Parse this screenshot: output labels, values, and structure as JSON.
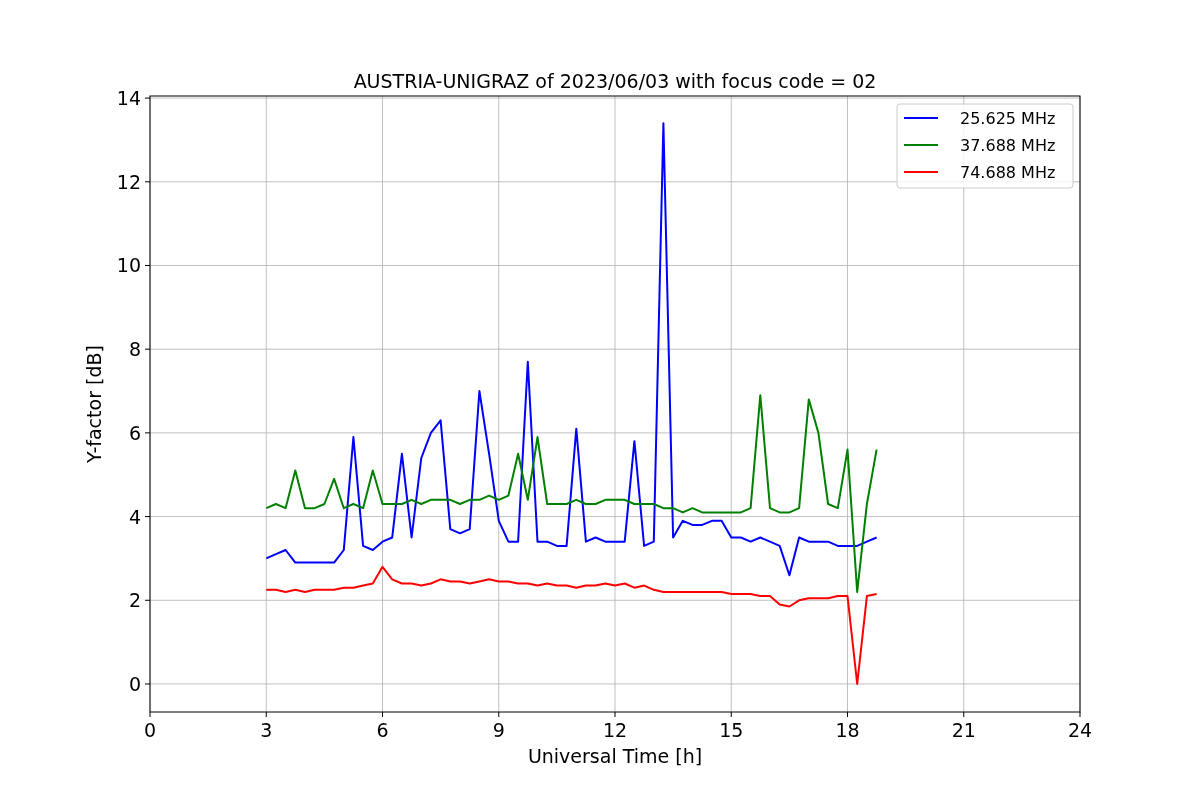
{
  "chart_data": {
    "type": "line",
    "title": "AUSTRIA-UNIGRAZ of 2023/06/03 with focus code = 02",
    "xlabel": "Universal Time [h]",
    "ylabel": "Y-factor [dB]",
    "x": [
      3,
      3.25,
      3.5,
      3.75,
      4,
      4.25,
      4.5,
      4.75,
      5,
      5.25,
      5.5,
      5.75,
      6,
      6.25,
      6.5,
      6.75,
      7,
      7.25,
      7.5,
      7.75,
      8,
      8.25,
      8.5,
      8.75,
      9,
      9.25,
      9.5,
      9.75,
      10,
      10.25,
      10.5,
      10.75,
      11,
      11.25,
      11.5,
      11.75,
      12,
      12.25,
      12.5,
      12.75,
      13,
      13.25,
      13.5,
      13.75,
      14,
      14.25,
      14.5,
      14.75,
      15,
      15.25,
      15.5,
      15.75,
      16,
      16.25,
      16.5,
      16.75,
      17,
      17.25,
      17.5,
      17.75,
      18,
      18.25,
      18.5,
      18.75
    ],
    "series": [
      {
        "name": "25.625 MHz",
        "color": "#0000ff",
        "values": [
          3.0,
          3.1,
          3.2,
          2.9,
          2.9,
          2.9,
          2.9,
          2.9,
          3.2,
          5.9,
          3.3,
          3.2,
          3.4,
          3.5,
          5.5,
          3.5,
          5.4,
          6.0,
          6.3,
          3.7,
          3.6,
          3.7,
          7.0,
          5.5,
          3.9,
          3.4,
          3.4,
          7.7,
          3.4,
          3.4,
          3.3,
          3.3,
          6.1,
          3.4,
          3.5,
          3.4,
          3.4,
          3.4,
          5.8,
          3.3,
          3.4,
          13.4,
          3.5,
          3.9,
          3.8,
          3.8,
          3.9,
          3.9,
          3.5,
          3.5,
          3.4,
          3.5,
          3.4,
          3.3,
          2.6,
          3.5,
          3.4,
          3.4,
          3.4,
          3.3,
          3.3,
          3.3,
          3.4,
          3.5
        ]
      },
      {
        "name": "37.688 MHz",
        "color": "#008000",
        "values": [
          4.2,
          4.3,
          4.2,
          5.1,
          4.2,
          4.2,
          4.3,
          4.9,
          4.2,
          4.3,
          4.2,
          5.1,
          4.3,
          4.3,
          4.3,
          4.4,
          4.3,
          4.4,
          4.4,
          4.4,
          4.3,
          4.4,
          4.4,
          4.5,
          4.4,
          4.5,
          5.5,
          4.4,
          5.9,
          4.3,
          4.3,
          4.3,
          4.4,
          4.3,
          4.3,
          4.4,
          4.4,
          4.4,
          4.3,
          4.3,
          4.3,
          4.2,
          4.2,
          4.1,
          4.2,
          4.1,
          4.1,
          4.1,
          4.1,
          4.1,
          4.2,
          6.9,
          4.2,
          4.1,
          4.1,
          4.2,
          6.8,
          6.0,
          4.3,
          4.2,
          5.6,
          2.2,
          4.3,
          5.6
        ]
      },
      {
        "name": "74.688 MHz",
        "color": "#ff0000",
        "values": [
          2.25,
          2.25,
          2.2,
          2.25,
          2.2,
          2.25,
          2.25,
          2.25,
          2.3,
          2.3,
          2.35,
          2.4,
          2.8,
          2.5,
          2.4,
          2.4,
          2.35,
          2.4,
          2.5,
          2.45,
          2.45,
          2.4,
          2.45,
          2.5,
          2.45,
          2.45,
          2.4,
          2.4,
          2.35,
          2.4,
          2.35,
          2.35,
          2.3,
          2.35,
          2.35,
          2.4,
          2.35,
          2.4,
          2.3,
          2.35,
          2.25,
          2.2,
          2.2,
          2.2,
          2.2,
          2.2,
          2.2,
          2.2,
          2.15,
          2.15,
          2.15,
          2.1,
          2.1,
          1.9,
          1.85,
          2.0,
          2.05,
          2.05,
          2.05,
          2.1,
          2.1,
          0.0,
          2.1,
          2.15
        ]
      }
    ],
    "xlim": [
      0,
      24
    ],
    "ylim": [
      -0.67,
      14.05
    ],
    "xticks": [
      0,
      3,
      6,
      9,
      12,
      15,
      18,
      21,
      24
    ],
    "yticks": [
      0,
      2,
      4,
      6,
      8,
      10,
      12,
      14
    ],
    "grid": true,
    "legend": "upper right"
  }
}
